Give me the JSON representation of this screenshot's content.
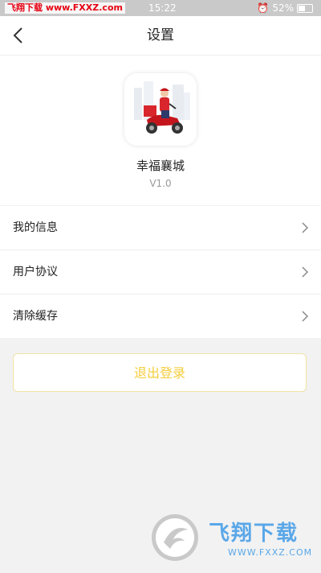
{
  "status_bar": {
    "watermark": "飞翔下载 www.FXXZ.com",
    "time": "15:22",
    "battery": "52%"
  },
  "navbar": {
    "title": "设置"
  },
  "app": {
    "name": "幸福襄城",
    "version": "V1.0"
  },
  "menu": {
    "items": [
      {
        "label": "我的信息"
      },
      {
        "label": "用户协议"
      },
      {
        "label": "清除缓存"
      }
    ]
  },
  "logout": {
    "label": "退出登录"
  },
  "watermark_corner": {
    "title": "飞翔下载",
    "url": "WWW.FXXZ.COM"
  },
  "colors": {
    "accent": "#f5cd3c",
    "background": "#f2f2f2"
  }
}
